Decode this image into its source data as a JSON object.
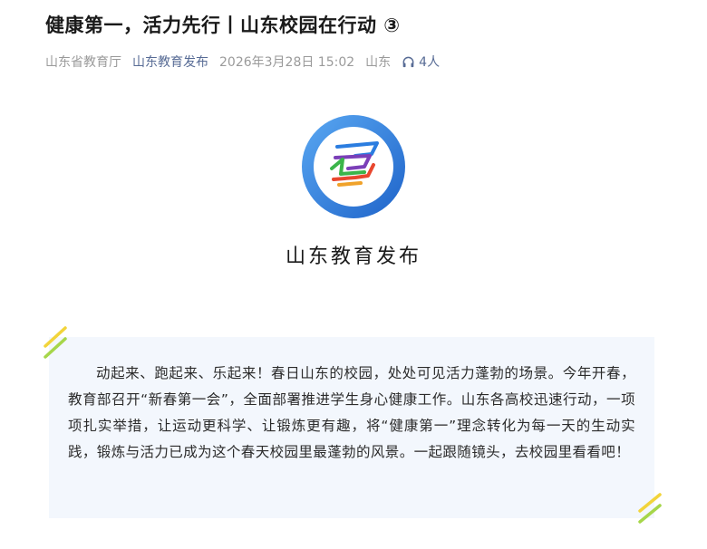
{
  "article": {
    "title": "健康第一，活力先行丨山东校园在行动 ③",
    "author": "山东省教育厅",
    "account": "山东教育发布",
    "datetime": "2026年3月28日 15:02",
    "location": "山东",
    "listen_count": "4人"
  },
  "brand": {
    "name": "山东教育发布"
  },
  "intro": {
    "text": "动起来、跑起来、乐起来！春日山东的校园，处处可见活力蓬勃的场景。今年开春，教育部召开“新春第一会”，全面部署推进学生身心健康工作。山东各高校迅速行动，一项项扎实举措，让运动更科学、让锻炼更有趣，将“健康第一”理念转化为每一天的生动实践，锻炼与活力已成为这个春天校园里最蓬勃的风景。一起跟随镜头，去校园里看看吧！"
  },
  "colors": {
    "account_link": "#576b95",
    "intro_background": "#f3f7fd",
    "logo_ring": "#2f7fe0",
    "deco_yellow": "#f2d43a",
    "deco_green": "#a6d64a"
  },
  "icons": {
    "listen": "headphones-icon",
    "logo": "shandong-education-logo"
  }
}
